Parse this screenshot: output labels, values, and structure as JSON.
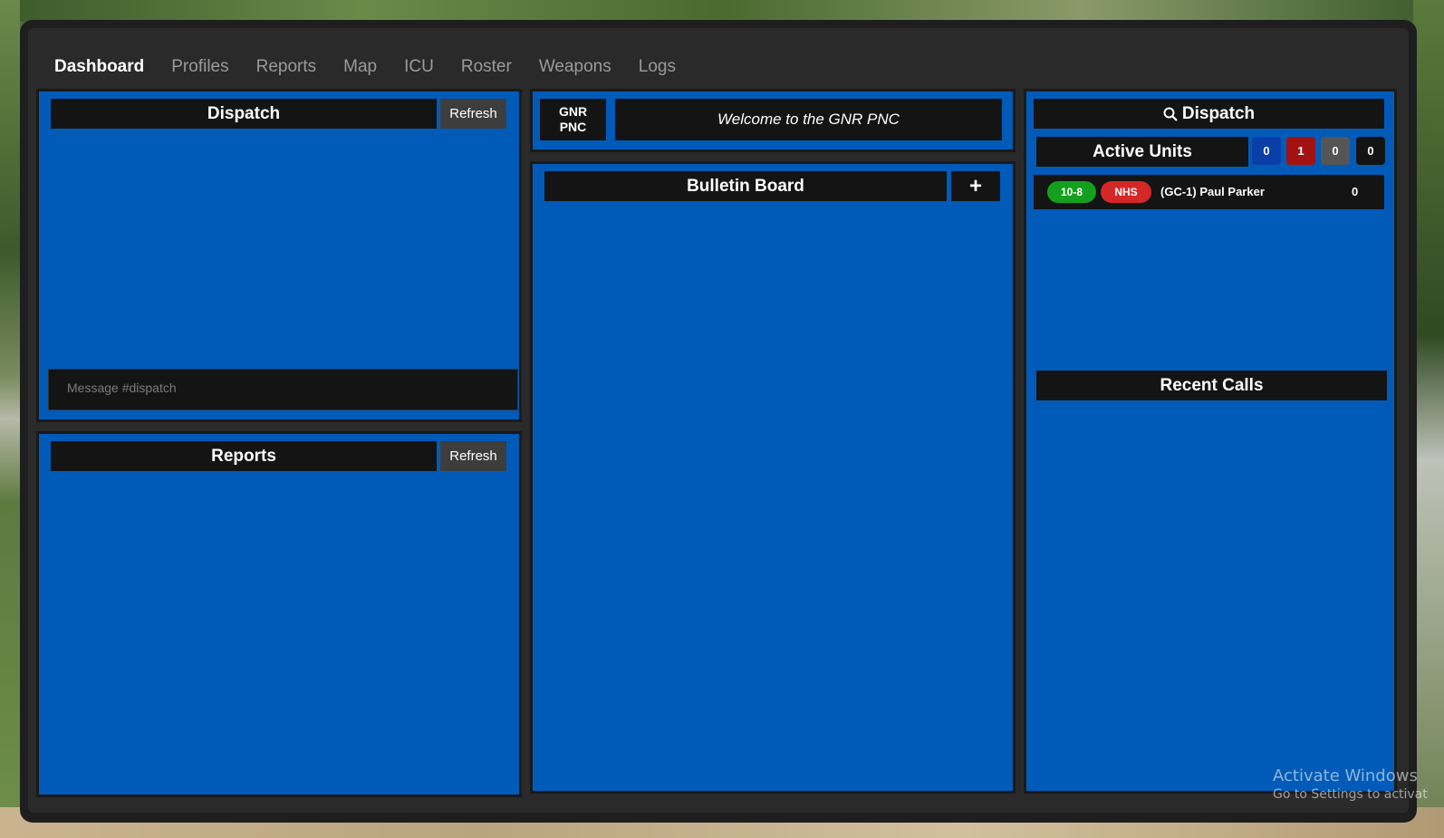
{
  "nav": {
    "items": [
      "Dashboard",
      "Profiles",
      "Reports",
      "Map",
      "ICU",
      "Roster",
      "Weapons",
      "Logs"
    ],
    "active": "Dashboard"
  },
  "dispatch_panel": {
    "title": "Dispatch",
    "refresh_label": "Refresh",
    "message_placeholder": "Message #dispatch"
  },
  "reports_panel": {
    "title": "Reports",
    "refresh_label": "Refresh"
  },
  "welcome": {
    "logo_line1": "GNR",
    "logo_line2": "PNC",
    "message": "Welcome to the GNR PNC"
  },
  "bulletin": {
    "title": "Bulletin Board",
    "add_label": "+"
  },
  "right_panel": {
    "search_dispatch_label": "Dispatch",
    "active_units_title": "Active Units",
    "unit_counts": [
      {
        "value": "0",
        "color": "#0a3fa8"
      },
      {
        "value": "1",
        "color": "#a31212"
      },
      {
        "value": "0",
        "color": "#555555"
      },
      {
        "value": "0",
        "color": "#141414"
      }
    ],
    "units": [
      {
        "status": "10-8",
        "status_color": "#14a01e",
        "dept": "NHS",
        "dept_color": "#d42828",
        "name": "(GC-1) Paul Parker",
        "count": "0"
      }
    ],
    "recent_calls_title": "Recent Calls"
  },
  "watermark": {
    "line1": "Activate Windows",
    "line2": "Go to Settings to activat"
  },
  "icons": {
    "search": "search-icon"
  }
}
